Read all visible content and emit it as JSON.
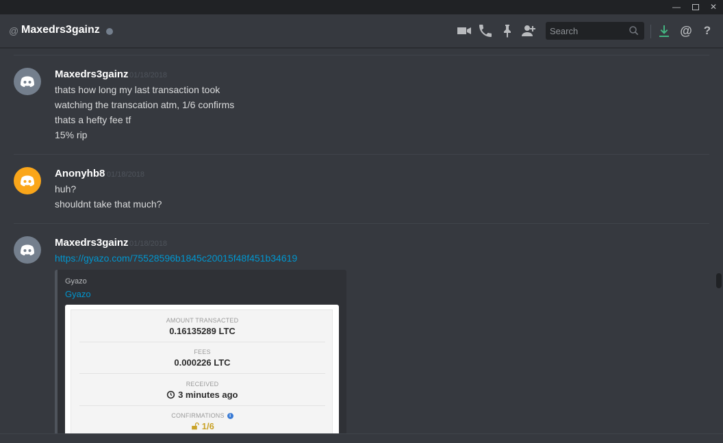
{
  "window": {
    "minimize_glyph": "—",
    "close_glyph": "✕"
  },
  "header": {
    "at_sign": "@",
    "channel_name": "Maxedrs3gainz",
    "status_color": "#747f8d",
    "icons": [
      "video-call-icon",
      "voice-call-icon",
      "pin-icon",
      "add-friend-icon",
      "download-icon",
      "mention-icon",
      "help-icon"
    ],
    "search_placeholder": "Search",
    "mention_glyph": "@",
    "help_glyph": "?"
  },
  "messages": [
    {
      "author": "Maxedrs3gainz",
      "timestamp": "01/18/2018",
      "avatar_color": "#747f8d",
      "lines": [
        "thats how long my last transaction took",
        "watching the transcation atm, 1/6 confirms",
        "thats a hefty fee tf",
        "15% rip"
      ]
    },
    {
      "author": "Anonyhb8",
      "timestamp": "01/18/2018",
      "avatar_color": "#faa61a",
      "lines": [
        "huh?",
        "shouldnt take that much?"
      ]
    },
    {
      "author": "Maxedrs3gainz",
      "timestamp": "01/18/2018",
      "avatar_color": "#747f8d",
      "link": "https://gyazo.com/75528596b1845c20015f48f451b34619",
      "embed": {
        "provider": "Gyazo",
        "title": "Gyazo",
        "image_fields": [
          {
            "label": "AMOUNT TRANSACTED",
            "value": "0.16135289 LTC"
          },
          {
            "label": "FEES",
            "value": "0.000226 LTC"
          },
          {
            "label": "RECEIVED",
            "value": "3 minutes ago",
            "icon": "clock-icon"
          },
          {
            "label": "CONFIRMATIONS",
            "value": "1/6",
            "icon": "unlock-icon",
            "info_glyph": "i"
          }
        ]
      }
    }
  ],
  "colors": {
    "background": "#36393f",
    "link": "#0096cf",
    "confirm_gold": "#c9a227"
  }
}
